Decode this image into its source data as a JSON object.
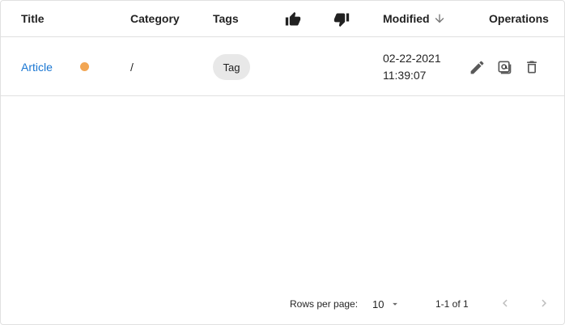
{
  "table": {
    "columns": {
      "title": "Title",
      "category": "Category",
      "tags": "Tags",
      "likes_icon": "thumb-up-icon",
      "dislikes_icon": "thumb-down-icon",
      "modified": "Modified",
      "modified_sort_icon": "arrow-down-icon",
      "operations": "Operations"
    },
    "rows": [
      {
        "title": "Article",
        "status_color": "#f2a654",
        "category": "/",
        "tag": "Tag",
        "modified_date": "02-22-2021",
        "modified_time": "11:39:07",
        "actions": [
          "pencil-icon",
          "at-sign-icon",
          "trash-icon"
        ]
      }
    ]
  },
  "pagination": {
    "rows_per_page_label": "Rows per page:",
    "rows_per_page_value": "10",
    "range_text": "1-1 of 1",
    "prev_icon": "chevron-left-icon",
    "next_icon": "chevron-right-icon"
  },
  "colors": {
    "link": "#1976d2",
    "status_dot": "#f2a654",
    "chip_bg": "#e8e8e8",
    "divider": "#e0e0e0"
  }
}
